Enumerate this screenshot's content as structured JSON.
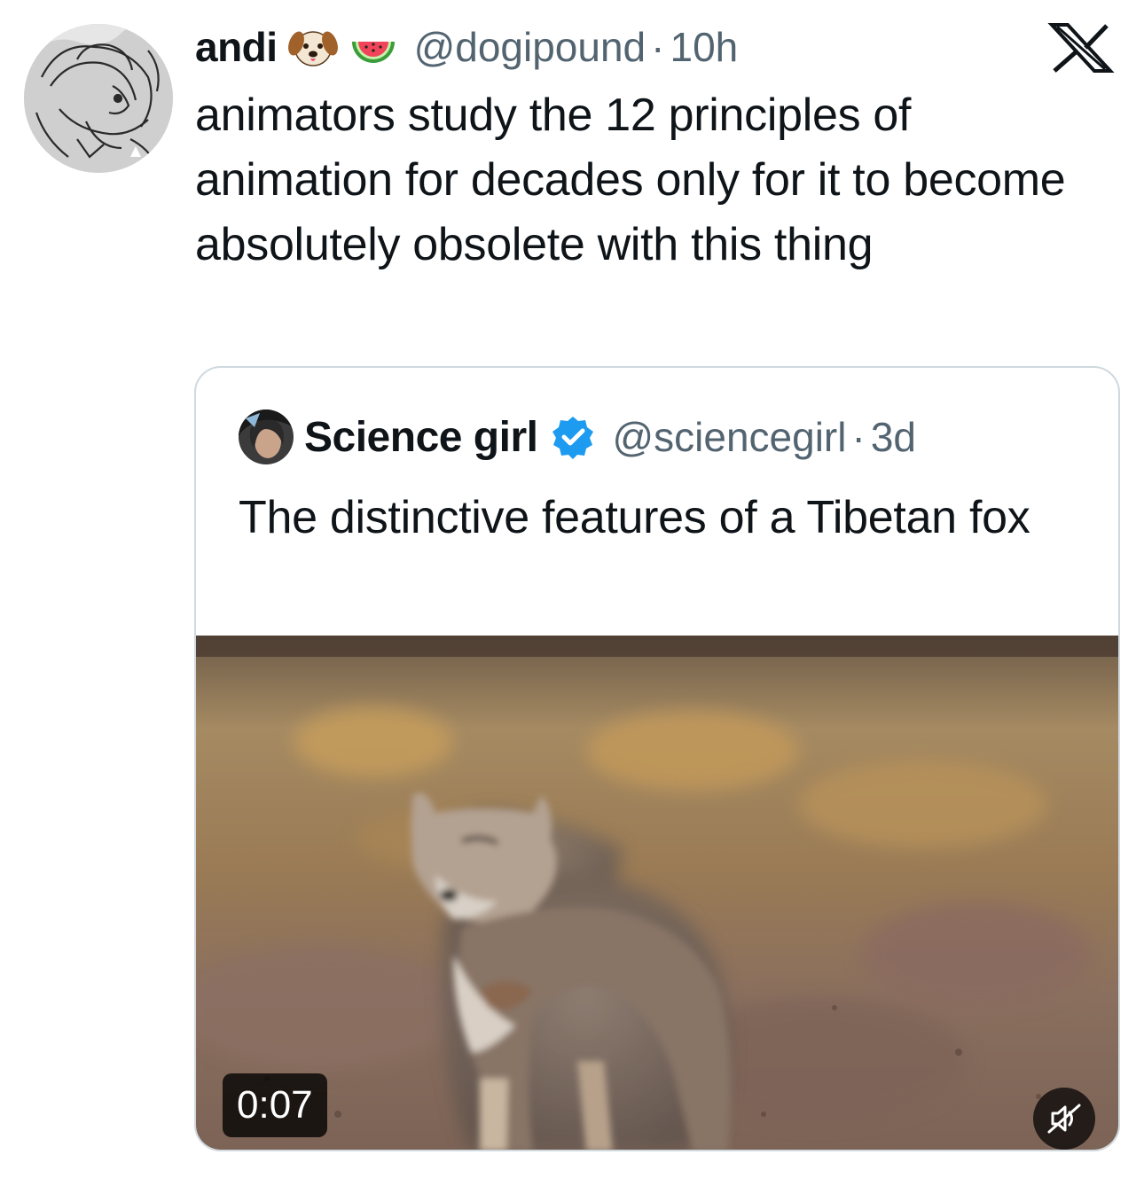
{
  "author": {
    "name": "andi",
    "emojis": [
      "dog-face-icon",
      "watermelon-icon"
    ],
    "handle": "@dogipound",
    "separator": "·",
    "time": "10h"
  },
  "platform_logo": "x-logo-icon",
  "post": {
    "text": "animators study the 12 principles of animation for decades only for it to become absolutely obsolete with this thing"
  },
  "quoted": {
    "name": "Science girl",
    "verified": true,
    "handle": "@sciencegirl",
    "separator": "·",
    "time": "3d",
    "text": "The distinctive features of a Tibetan fox",
    "media": {
      "type": "video",
      "duration": "0:07",
      "muted": true
    }
  },
  "colors": {
    "text": "#0f1419",
    "secondary": "#536471",
    "border": "#cfd9de",
    "verified": "#1d9bf0"
  }
}
